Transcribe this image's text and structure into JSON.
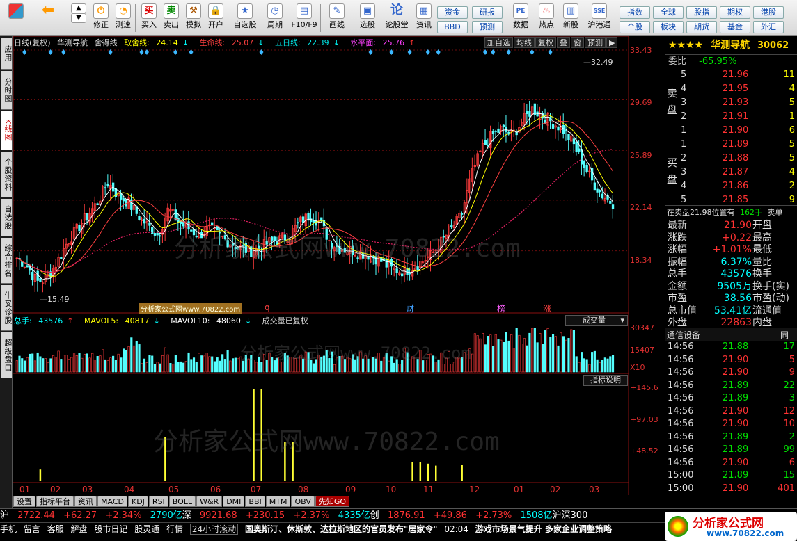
{
  "toolbar": {
    "buttons": [
      "",
      "",
      "修正",
      "测速",
      "买入",
      "卖出",
      "模拟",
      "开户",
      "自选股",
      "周期",
      "F10/F9",
      "画线",
      "选股",
      "论股堂",
      "资讯",
      "数据",
      "热点",
      "新股",
      "沪港通"
    ],
    "right_buttons": {
      "zijin": "资金",
      "yanbao": "研报",
      "bbd": "BBD",
      "yuce": "预测",
      "zhishu": "指数",
      "quanqiu": "全球",
      "guzhi": "股指",
      "qiquan": "期权",
      "ganggu": "港股",
      "gegu": "个股",
      "bankuai": "板块",
      "qihuo": "期货",
      "jijin": "基金",
      "waihui": "外汇"
    }
  },
  "left_tabs": [
    "应用",
    "分时图",
    "K线图",
    "个股资料",
    "自选股",
    "综合排名",
    "牛叉诊股",
    "超级盘口"
  ],
  "title_line": {
    "period": "日线(复权)",
    "name": "华测导航",
    "indicator": "舍得线",
    "qushe_label": "取舍线:",
    "qushe_value": "24.14",
    "shengming_label": "生命线:",
    "shengming_value": "25.07",
    "wuri_label": "五日线:",
    "wuri_value": "22.39",
    "shuiping_label": "水平面:",
    "shuiping_value": "25.76"
  },
  "chart_buttons": [
    "加自选",
    "均线",
    "复权",
    "叠",
    "窗",
    "预测",
    "▶"
  ],
  "price_axis": [
    "33.43",
    "29.69",
    "25.89",
    "22.14",
    "18.34"
  ],
  "vol_axis": [
    "30347",
    "15407",
    "X10"
  ],
  "ind_axis": [
    "+145.6",
    "+97.03",
    "+48.52"
  ],
  "annotations": {
    "high": "32.49",
    "low": "15.49"
  },
  "events": [
    "q",
    "财",
    "榜",
    "涨"
  ],
  "site_watermark": "分析家公式网www.70822.com",
  "vol_line": {
    "total_label": "总手:",
    "total_value": "43576",
    "ma5_label": "MAVOL5:",
    "ma5_value": "40817",
    "ma10_label": "MAVOL10:",
    "ma10_value": "48060",
    "note": "成交量已复权",
    "dropdown": "成交量"
  },
  "indicator_button": "指标说明",
  "x_axis": [
    "01",
    "02",
    "03",
    "04",
    "05",
    "06",
    "07",
    "08",
    "09",
    "10",
    "11",
    "12",
    "01",
    "02",
    "03"
  ],
  "bottom_tabs": [
    "设置",
    "指标平台",
    "资讯",
    "MACD",
    "KDJ",
    "RSI",
    "BOLL",
    "W&R",
    "DMI",
    "BBI",
    "MTM",
    "OBV",
    "先知GO"
  ],
  "right_panel": {
    "stars": "★★★★",
    "stock_name": "华测导航",
    "stock_code": "30062",
    "weibi_label": "委比",
    "weibi_value": "-65.95%",
    "sell_label": "卖盘",
    "buy_label": "买盘",
    "sells": [
      {
        "n": "5",
        "price": "21.96",
        "vol": "11"
      },
      {
        "n": "4",
        "price": "21.95",
        "vol": "4"
      },
      {
        "n": "3",
        "price": "21.93",
        "vol": "5"
      },
      {
        "n": "2",
        "price": "21.91",
        "vol": "1"
      },
      {
        "n": "1",
        "price": "21.90",
        "vol": "6"
      }
    ],
    "buys": [
      {
        "n": "1",
        "price": "21.89",
        "vol": "5"
      },
      {
        "n": "2",
        "price": "21.88",
        "vol": "5"
      },
      {
        "n": "3",
        "price": "21.87",
        "vol": "4"
      },
      {
        "n": "4",
        "price": "21.86",
        "vol": "2"
      },
      {
        "n": "5",
        "price": "21.85",
        "vol": "9"
      }
    ],
    "position_line": "在卖盘21.98位置有",
    "position_vol": "162手",
    "position_side": "卖单",
    "stats": [
      {
        "l": "最新",
        "v": "21.90",
        "l2": "开盘",
        "c": "red"
      },
      {
        "l": "涨跌",
        "v": "+0.22",
        "l2": "最高",
        "c": "red"
      },
      {
        "l": "涨幅",
        "v": "+1.01%",
        "l2": "最低",
        "c": "red"
      },
      {
        "l": "振幅",
        "v": "6.37%",
        "l2": "量比",
        "c": "cyan"
      },
      {
        "l": "总手",
        "v": "43576",
        "l2": "换手",
        "c": "cyan"
      },
      {
        "l": "金额",
        "v": "9505万",
        "l2": "换手(实)",
        "c": "cyan"
      },
      {
        "l": "市盈",
        "v": "38.56",
        "l2": "市盈(动)",
        "c": "cyan"
      },
      {
        "l": "总市值",
        "v": "53.41亿",
        "l2": "流通值",
        "c": "cyan"
      },
      {
        "l": "外盘",
        "v": "22863",
        "l2": "内盘",
        "c": "red"
      }
    ],
    "trade_header": "通信设备",
    "trade_header_right": "同",
    "trades": [
      {
        "t": "14:56",
        "p": "21.88",
        "v": "17",
        "c": "green"
      },
      {
        "t": "14:56",
        "p": "21.90",
        "v": "5",
        "c": "red"
      },
      {
        "t": "14:56",
        "p": "21.90",
        "v": "9",
        "c": "red"
      },
      {
        "t": "14:56",
        "p": "21.89",
        "v": "22",
        "c": "green"
      },
      {
        "t": "14:56",
        "p": "21.89",
        "v": "3",
        "c": "green"
      },
      {
        "t": "14:56",
        "p": "21.90",
        "v": "12",
        "c": "red"
      },
      {
        "t": "14:56",
        "p": "21.90",
        "v": "10",
        "c": "red"
      },
      {
        "t": "14:56",
        "p": "21.89",
        "v": "2",
        "c": "green"
      },
      {
        "t": "14:56",
        "p": "21.89",
        "v": "99",
        "c": "green"
      },
      {
        "t": "14:56",
        "p": "21.90",
        "v": "6",
        "c": "red"
      },
      {
        "t": "15:00",
        "p": "21.89",
        "v": "15",
        "c": "green"
      },
      {
        "t": "15:00",
        "p": "21.90",
        "v": "401",
        "c": "red"
      }
    ]
  },
  "ticker1": {
    "sh_label": "沪",
    "sh_value": "2722.44",
    "sh_chg": "+62.27",
    "sh_pct": "+2.34%",
    "sh_amt": "2790亿",
    "sz_label": "深",
    "sz_value": "9921.68",
    "sz_chg": "+230.15",
    "sz_pct": "+2.37%",
    "sz_amt": "4335亿",
    "cy_label": "创",
    "cy_value": "1876.91",
    "cy_chg": "+49.86",
    "cy_pct": "+2.73%",
    "cy_amt": "1508亿",
    "hs300": "沪深300"
  },
  "ticker2": {
    "items": [
      "手机",
      "留言",
      "客服",
      "解盘",
      "股市日记",
      "股灵通",
      "行情",
      "24小时滚动"
    ],
    "news": "国奥斯汀、休斯敦、达拉斯地区的官员发布\"居家令\"",
    "news_time": "02:04",
    "news2": "游戏市场景气提升 多家企业调整策略"
  },
  "logo": "分析家公式网",
  "logo_url": "www.70822.com",
  "chart_data": {
    "type": "candlestick",
    "x_labels": [
      "01",
      "02",
      "03",
      "04",
      "05",
      "06",
      "07",
      "08",
      "09",
      "10",
      "11",
      "12",
      "01",
      "02",
      "03"
    ],
    "y_ticks": [
      33.43,
      29.69,
      25.89,
      22.14,
      18.34
    ],
    "ylim": [
      14.5,
      33.43
    ],
    "closes": [
      17.8,
      17.2,
      16.0,
      16.3,
      17.5,
      19.0,
      20.0,
      21.0,
      22.0,
      23.5,
      22.5,
      22.0,
      21.0,
      20.2,
      19.5,
      21.5,
      20.5,
      20.0,
      19.5,
      20.0,
      19.5,
      19.0,
      18.6,
      18.3,
      18.5,
      19.0,
      19.2,
      19.5,
      20.5,
      21.0,
      20.5,
      19.0,
      18.5,
      18.4,
      18.2,
      18.0,
      17.6,
      17.0,
      16.8,
      17.0,
      17.5,
      18.0,
      19.0,
      20.0,
      21.0,
      24.0,
      26.0,
      27.0,
      27.5,
      27.0,
      28.0,
      29.0,
      28.5,
      28.0,
      27.5,
      26.5,
      25.0,
      23.5,
      22.5,
      21.9
    ],
    "volume_axis": [
      30347,
      15407
    ],
    "volume_scale": "X10"
  }
}
